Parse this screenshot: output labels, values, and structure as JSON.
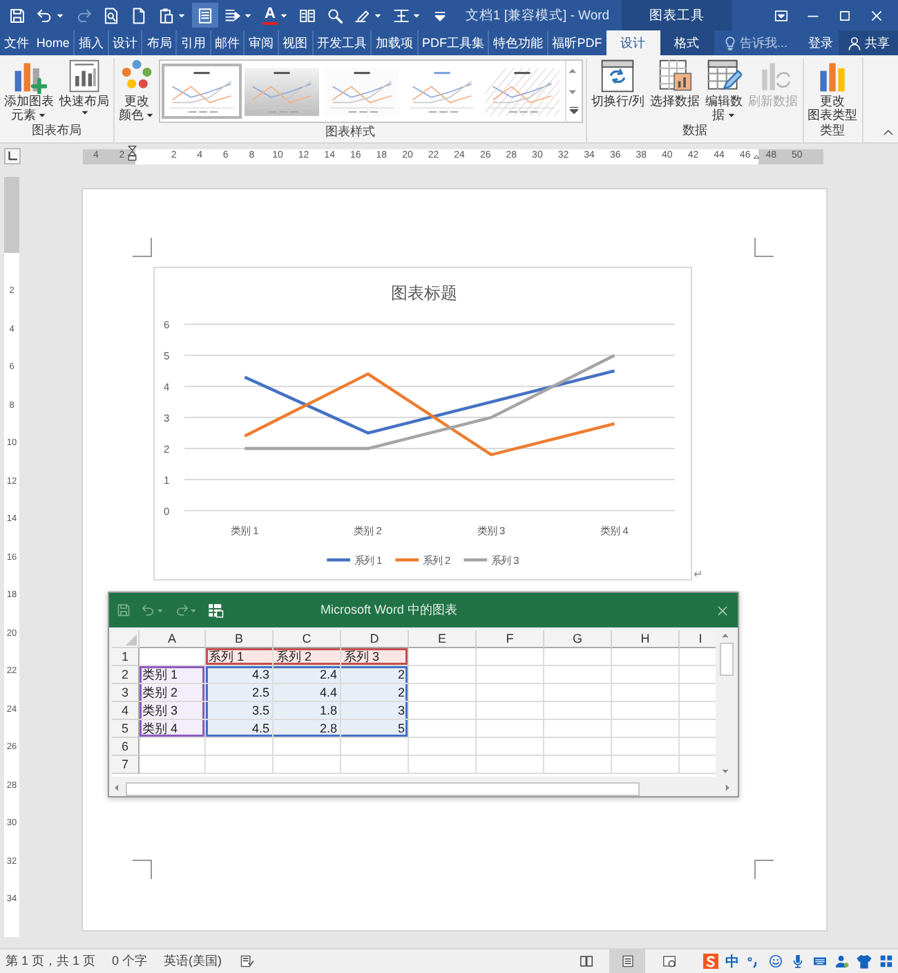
{
  "title_bar": {
    "title": "文档1 [兼容模式] - Word",
    "context_label": "图表工具",
    "quick_access": [
      {
        "kind": "save",
        "dropdown": false,
        "disabled": false,
        "selected": false
      },
      {
        "kind": "undo",
        "dropdown": true,
        "disabled": false,
        "selected": false
      },
      {
        "kind": "redo",
        "dropdown": false,
        "disabled": true,
        "selected": false
      },
      {
        "kind": "preview",
        "dropdown": false,
        "disabled": false,
        "selected": false
      },
      {
        "kind": "new",
        "dropdown": false,
        "disabled": false,
        "selected": false
      },
      {
        "kind": "paste",
        "dropdown": true,
        "disabled": false,
        "selected": false
      },
      {
        "kind": "read",
        "dropdown": false,
        "disabled": false,
        "selected": true
      },
      {
        "kind": "layout",
        "dropdown": true,
        "disabled": false,
        "selected": false
      },
      {
        "kind": "font_color",
        "label": "A",
        "dropdown": true,
        "disabled": false,
        "selected": false
      },
      {
        "kind": "columns",
        "dropdown": false,
        "disabled": false,
        "selected": false
      },
      {
        "kind": "find",
        "dropdown": false,
        "disabled": false,
        "selected": false
      },
      {
        "kind": "draw",
        "dropdown": true,
        "disabled": false,
        "selected": false
      },
      {
        "kind": "border",
        "dropdown": true,
        "disabled": false,
        "selected": false
      },
      {
        "kind": "customize",
        "dropdown": false,
        "disabled": false,
        "selected": false
      }
    ]
  },
  "tabs": [
    {
      "label": "文件",
      "selected": false,
      "contextual": false
    },
    {
      "label": "Home",
      "selected": false,
      "contextual": false
    },
    {
      "label": "插入",
      "selected": false,
      "contextual": false
    },
    {
      "label": "设计",
      "selected": false,
      "contextual": false
    },
    {
      "label": "布局",
      "selected": false,
      "contextual": false
    },
    {
      "label": "引用",
      "selected": false,
      "contextual": false
    },
    {
      "label": "邮件",
      "selected": false,
      "contextual": false
    },
    {
      "label": "审阅",
      "selected": false,
      "contextual": false
    },
    {
      "label": "视图",
      "selected": false,
      "contextual": false
    },
    {
      "label": "开发工具",
      "selected": false,
      "contextual": false
    },
    {
      "label": "加载项",
      "selected": false,
      "contextual": false
    },
    {
      "label": "PDF工具集",
      "selected": false,
      "contextual": false
    },
    {
      "label": "特色功能",
      "selected": false,
      "contextual": false
    },
    {
      "label": "福昕PDF",
      "selected": false,
      "contextual": false
    },
    {
      "label": "设计",
      "selected": true,
      "contextual": true
    },
    {
      "label": "格式",
      "selected": false,
      "contextual": true
    }
  ],
  "tell_me": {
    "placeholder": "告诉我..."
  },
  "account": {
    "sign_in": "登录",
    "share": "共享"
  },
  "ribbon": {
    "groups": [
      {
        "label": "图表布局",
        "items": [
          {
            "kind": "add_element",
            "lines": [
              "添加图表",
              "元素"
            ],
            "dropdown": true,
            "disabled": false
          },
          {
            "kind": "quick_layout",
            "lines": [
              "快速布局"
            ],
            "dropdown": true,
            "disabled": false
          }
        ]
      },
      {
        "label": "图表样式",
        "items": [
          {
            "kind": "colors",
            "lines": [
              "更改",
              "颜色"
            ],
            "dropdown": true,
            "disabled": false
          },
          {
            "kind": "gallery",
            "styles": [
              {
                "selected": true
              },
              {
                "selected": false
              },
              {
                "selected": false
              },
              {
                "selected": false
              },
              {
                "selected": false
              }
            ]
          }
        ]
      },
      {
        "label": "数据",
        "items": [
          {
            "kind": "switch",
            "lines": [
              "切换行/列"
            ],
            "dropdown": false,
            "disabled": false
          },
          {
            "kind": "select",
            "lines": [
              "选择数据"
            ],
            "dropdown": false,
            "disabled": false
          },
          {
            "kind": "edit",
            "lines": [
              "编辑数",
              "据"
            ],
            "dropdown": true,
            "disabled": false
          },
          {
            "kind": "refresh",
            "lines": [
              "刷新数据"
            ],
            "dropdown": false,
            "disabled": true
          }
        ]
      },
      {
        "label": "类型",
        "items": [
          {
            "kind": "change_type",
            "lines": [
              "更改",
              "图表类型"
            ],
            "dropdown": false,
            "disabled": false
          }
        ]
      }
    ]
  },
  "ruler": {
    "ticks": [
      {
        "label": "4",
        "margin": true
      },
      {
        "label": "2",
        "margin": true
      },
      {
        "label": "2",
        "margin": false
      },
      {
        "label": "4",
        "margin": false
      },
      {
        "label": "6",
        "margin": false
      },
      {
        "label": "8",
        "margin": false
      },
      {
        "label": "10",
        "margin": false
      },
      {
        "label": "12",
        "margin": false
      },
      {
        "label": "14",
        "margin": false
      },
      {
        "label": "16",
        "margin": false
      },
      {
        "label": "18",
        "margin": false
      },
      {
        "label": "20",
        "margin": false
      },
      {
        "label": "22",
        "margin": false
      },
      {
        "label": "24",
        "margin": false
      },
      {
        "label": "26",
        "margin": false
      },
      {
        "label": "28",
        "margin": false
      },
      {
        "label": "30",
        "margin": false
      },
      {
        "label": "32",
        "margin": false
      },
      {
        "label": "34",
        "margin": false
      },
      {
        "label": "36",
        "margin": false
      },
      {
        "label": "38",
        "margin": false
      },
      {
        "label": "40",
        "margin": false
      },
      {
        "label": "42",
        "margin": false
      },
      {
        "label": "44",
        "margin": false
      },
      {
        "label": "46",
        "margin": false
      },
      {
        "label": "48",
        "margin": true
      },
      {
        "label": "50",
        "margin": true
      }
    ]
  },
  "vertical_ruler": {
    "ticks": [
      "2",
      "4",
      "6",
      "8",
      "10",
      "12",
      "14",
      "16",
      "18",
      "20",
      "22",
      "24",
      "26",
      "28",
      "30",
      "32",
      "34"
    ]
  },
  "chart": {
    "paragraph_mark": "↵",
    "chart_data": {
      "type": "line",
      "title": "图表标题",
      "categories": [
        "类别 1",
        "类别 2",
        "类别 3",
        "类别 4"
      ],
      "series": [
        {
          "name": "系列 1",
          "color": "#4472c4",
          "values": [
            4.3,
            2.5,
            3.5,
            4.5
          ]
        },
        {
          "name": "系列 2",
          "color": "#ed7d31",
          "values": [
            2.4,
            4.4,
            1.8,
            2.8
          ]
        },
        {
          "name": "系列 3",
          "color": "#a5a5a5",
          "values": [
            2,
            2,
            3,
            5
          ]
        }
      ],
      "ylim": [
        0,
        6
      ],
      "yticks": [
        0,
        1,
        2,
        3,
        4,
        5,
        6
      ],
      "grid": true,
      "legend": true
    }
  },
  "spreadsheet": {
    "title": "Microsoft Word 中的图表",
    "columns": [
      "A",
      "B",
      "C",
      "D",
      "E",
      "F",
      "G",
      "H",
      "I"
    ],
    "rows": [
      {
        "label": "1",
        "cells": [
          {
            "kind": "blank"
          },
          {
            "kind": "series",
            "text": "系列 1"
          },
          {
            "kind": "series",
            "text": "系列 2"
          },
          {
            "kind": "series",
            "text": "系列 3"
          }
        ]
      },
      {
        "label": "2",
        "cells": [
          {
            "kind": "category",
            "text": "类别 1"
          },
          {
            "kind": "values",
            "text": "4.3"
          },
          {
            "kind": "values",
            "text": "2.4"
          },
          {
            "kind": "values",
            "text": "2"
          }
        ]
      },
      {
        "label": "3",
        "cells": [
          {
            "kind": "category",
            "text": "类别 2"
          },
          {
            "kind": "values",
            "text": "2.5"
          },
          {
            "kind": "values",
            "text": "4.4"
          },
          {
            "kind": "values",
            "text": "2"
          }
        ]
      },
      {
        "label": "4",
        "cells": [
          {
            "kind": "category",
            "text": "类别 3"
          },
          {
            "kind": "values",
            "text": "3.5"
          },
          {
            "kind": "values",
            "text": "1.8"
          },
          {
            "kind": "values",
            "text": "3"
          }
        ]
      },
      {
        "label": "5",
        "cells": [
          {
            "kind": "category",
            "text": "类别 4"
          },
          {
            "kind": "values",
            "text": "4.5"
          },
          {
            "kind": "values",
            "text": "2.8"
          },
          {
            "kind": "values",
            "text": "5"
          }
        ]
      },
      {
        "label": "6"
      },
      {
        "label": "7"
      }
    ]
  },
  "status_bar": {
    "page": "第 1 页，共 1 页",
    "words": "0 个字",
    "language": "英语(美国)",
    "views": [
      {
        "kind": "read",
        "selected": false
      },
      {
        "kind": "print",
        "selected": true
      },
      {
        "kind": "web",
        "selected": false
      }
    ],
    "tray": [
      {
        "kind": "sogou"
      },
      {
        "kind": "text",
        "label": "中"
      },
      {
        "kind": "punct"
      },
      {
        "kind": "smile"
      },
      {
        "kind": "mic"
      },
      {
        "kind": "keyboard"
      },
      {
        "kind": "user"
      },
      {
        "kind": "shirt"
      },
      {
        "kind": "grid"
      }
    ]
  }
}
